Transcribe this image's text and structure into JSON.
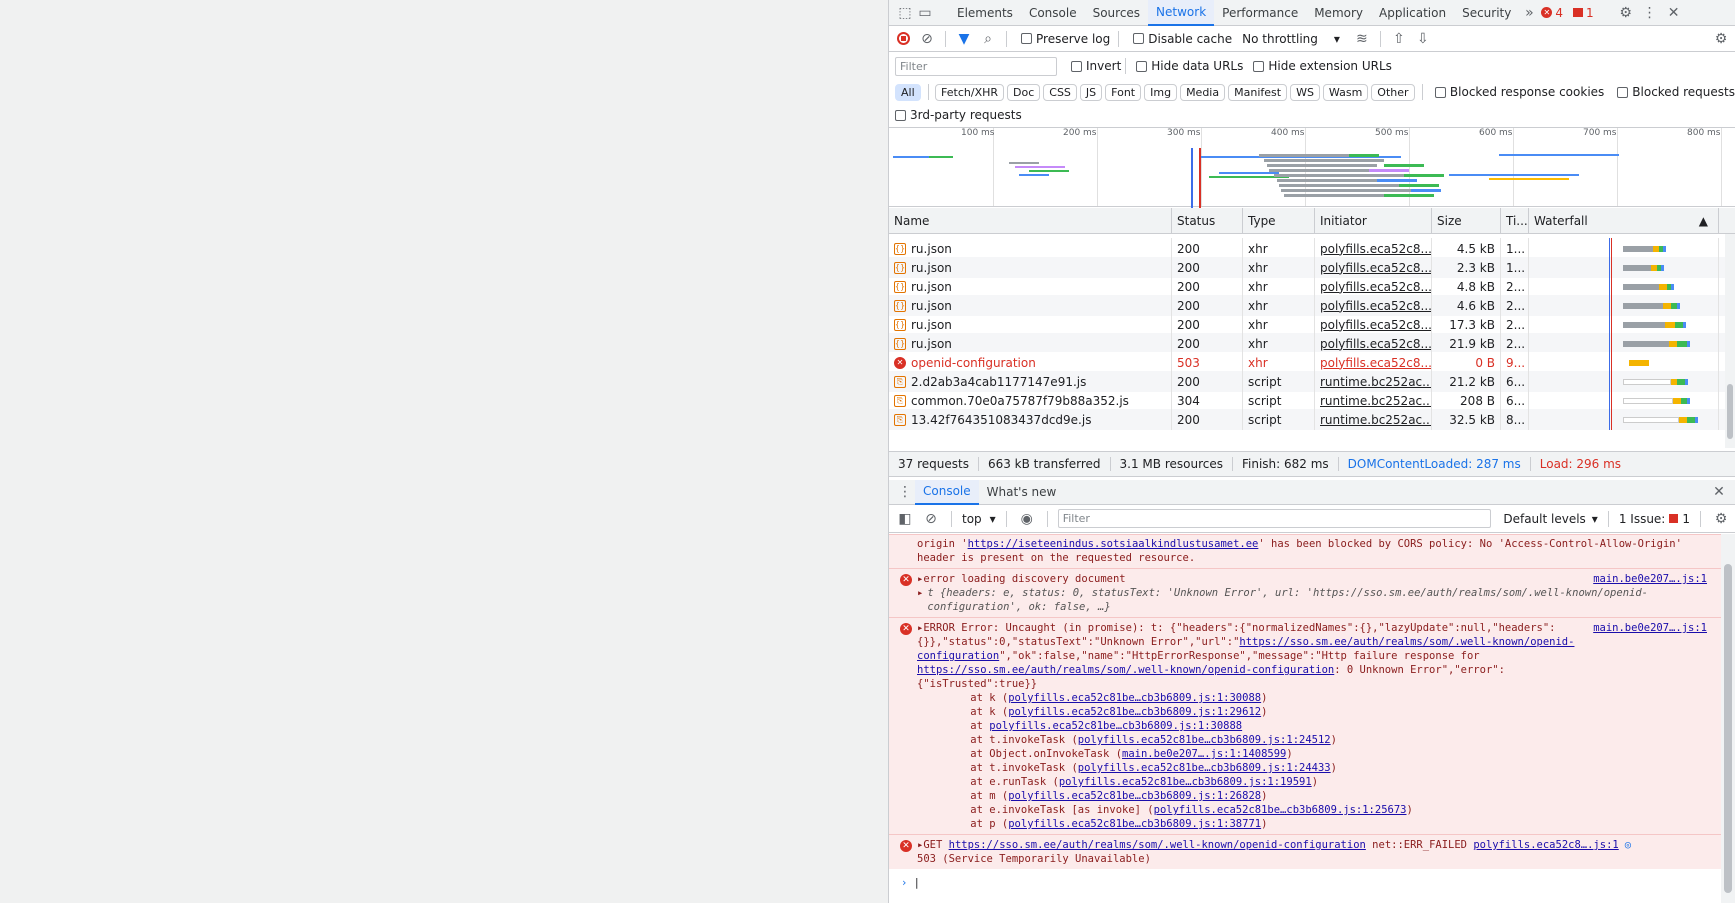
{
  "tabs": [
    "Elements",
    "Console",
    "Sources",
    "Network",
    "Performance",
    "Memory",
    "Application",
    "Security"
  ],
  "active_tab": "Network",
  "tab_badges": {
    "errors": "4",
    "issues": "1"
  },
  "toolbar": {
    "preserve_log": "Preserve log",
    "disable_cache": "Disable cache",
    "throttling": "No throttling"
  },
  "filter": {
    "placeholder": "Filter",
    "invert": "Invert",
    "hide_data": "Hide data URLs",
    "hide_ext": "Hide extension URLs"
  },
  "types": [
    "All",
    "Fetch/XHR",
    "Doc",
    "CSS",
    "JS",
    "Font",
    "Img",
    "Media",
    "Manifest",
    "WS",
    "Wasm",
    "Other"
  ],
  "blocked_cookies": "Blocked response cookies",
  "blocked_requests": "Blocked requests",
  "third_party": "3rd-party requests",
  "overview_ticks": [
    "100 ms",
    "200 ms",
    "300 ms",
    "400 ms",
    "500 ms",
    "600 ms",
    "700 ms",
    "800 ms"
  ],
  "columns": [
    "Name",
    "Status",
    "Type",
    "Initiator",
    "Size",
    "Ti...",
    "Waterfall"
  ],
  "rows": [
    {
      "name": "ru.json",
      "status": "200",
      "type": "xhr",
      "initiator": "polyfills.eca52c8....",
      "size": "4.5 kB",
      "time": "1..."
    },
    {
      "name": "ru.json",
      "status": "200",
      "type": "xhr",
      "initiator": "polyfills.eca52c8....",
      "size": "2.3 kB",
      "time": "1..."
    },
    {
      "name": "ru.json",
      "status": "200",
      "type": "xhr",
      "initiator": "polyfills.eca52c8....",
      "size": "4.8 kB",
      "time": "2..."
    },
    {
      "name": "ru.json",
      "status": "200",
      "type": "xhr",
      "initiator": "polyfills.eca52c8....",
      "size": "4.6 kB",
      "time": "2..."
    },
    {
      "name": "ru.json",
      "status": "200",
      "type": "xhr",
      "initiator": "polyfills.eca52c8....",
      "size": "17.3 kB",
      "time": "2..."
    },
    {
      "name": "ru.json",
      "status": "200",
      "type": "xhr",
      "initiator": "polyfills.eca52c8....",
      "size": "21.9 kB",
      "time": "2..."
    },
    {
      "name": "openid-configuration",
      "status": "503",
      "type": "xhr",
      "initiator": "polyfills.eca52c8....",
      "size": "0 B",
      "time": "9...",
      "error": true
    },
    {
      "name": "2.d2ab3a4cab1177147e91.js",
      "status": "200",
      "type": "script",
      "initiator": "runtime.bc252ac....",
      "size": "21.2 kB",
      "time": "6..."
    },
    {
      "name": "common.70e0a75787f79b88a352.js",
      "status": "304",
      "type": "script",
      "initiator": "runtime.bc252ac....",
      "size": "208 B",
      "time": "6..."
    },
    {
      "name": "13.42f764351083437dcd9e.js",
      "status": "200",
      "type": "script",
      "initiator": "runtime.bc252ac....",
      "size": "32.5 kB",
      "time": "8..."
    }
  ],
  "summary": {
    "requests": "37 requests",
    "transferred": "663 kB transferred",
    "resources": "3.1 MB resources",
    "finish": "Finish: 682 ms",
    "dcl": "DOMContentLoaded: 287 ms",
    "load": "Load: 296 ms"
  },
  "drawer_tabs": [
    "Console",
    "What's new"
  ],
  "console_toolbar": {
    "context": "top",
    "filter": "Filter",
    "levels": "Default levels",
    "issues": "1 Issue:",
    "issues_count": "1"
  },
  "messages": {
    "cors_prefix": "origin '",
    "cors_url": "https://iseteenindus.sotsiaalkindlustusamet.ee",
    "cors_suffix": "' has been blocked by CORS policy: No 'Access-Control-Allow-Origin' header is present on the requested resource.",
    "m1_text": "error loading discovery document",
    "m1_src": "main.be0e207….js:1",
    "m1_obj": "t {headers: e, status: 0, statusText: 'Unknown Error', url: 'https://sso.sm.ee/auth/realms/som/.well-known/openid-configuration', ok: false, …}",
    "m2_text": "ERROR Error: Uncaught (in promise): t: {\"headers\":{\"normalizedNames\":{},\"lazyUpdate\":null,\"headers\":{}},\"status\":0,\"statusText\":\"Unknown Error\",\"url\":\"",
    "m2_url": "https://sso.sm.ee/auth/realms/som/.well-known/openid-configuration",
    "m2_mid": "\",\"ok\":false,\"name\":\"HttpErrorResponse\",\"message\":\"Http failure response for ",
    "m2_url2": "https://sso.sm.ee/auth/realms/som/.well-known/openid-configuration",
    "m2_end": ": 0 Unknown Error\",\"error\":{\"isTrusted\":true}}",
    "m2_src": "main.be0e207….js:1",
    "stack": [
      [
        "at k (",
        "polyfills.eca52c81be…cb3b6809.js:1:30088",
        ")"
      ],
      [
        "at k (",
        "polyfills.eca52c81be…cb3b6809.js:1:29612",
        ")"
      ],
      [
        "at ",
        "polyfills.eca52c81be…cb3b6809.js:1:30888",
        ""
      ],
      [
        "at t.invokeTask (",
        "polyfills.eca52c81be…cb3b6809.js:1:24512",
        ")"
      ],
      [
        "at Object.onInvokeTask (",
        "main.be0e207….js:1:1408599",
        ")"
      ],
      [
        "at t.invokeTask (",
        "polyfills.eca52c81be…cb3b6809.js:1:24433",
        ")"
      ],
      [
        "at e.runTask (",
        "polyfills.eca52c81be…cb3b6809.js:1:19591",
        ")"
      ],
      [
        "at m (",
        "polyfills.eca52c81be…cb3b6809.js:1:26828",
        ")"
      ],
      [
        "at e.invokeTask [as invoke] (",
        "polyfills.eca52c81be…cb3b6809.js:1:25673",
        ")"
      ],
      [
        "at p (",
        "polyfills.eca52c81be…cb3b6809.js:1:38771",
        ")"
      ]
    ],
    "m3_get": "GET ",
    "m3_url": "https://sso.sm.ee/auth/realms/som/.well-known/openid-configuration",
    "m3_status": " net::ERR_FAILED ",
    "m3_src": "polyfills.eca52c8….js:1",
    "m3_line2": "503 (Service Temporarily Unavailable)"
  }
}
